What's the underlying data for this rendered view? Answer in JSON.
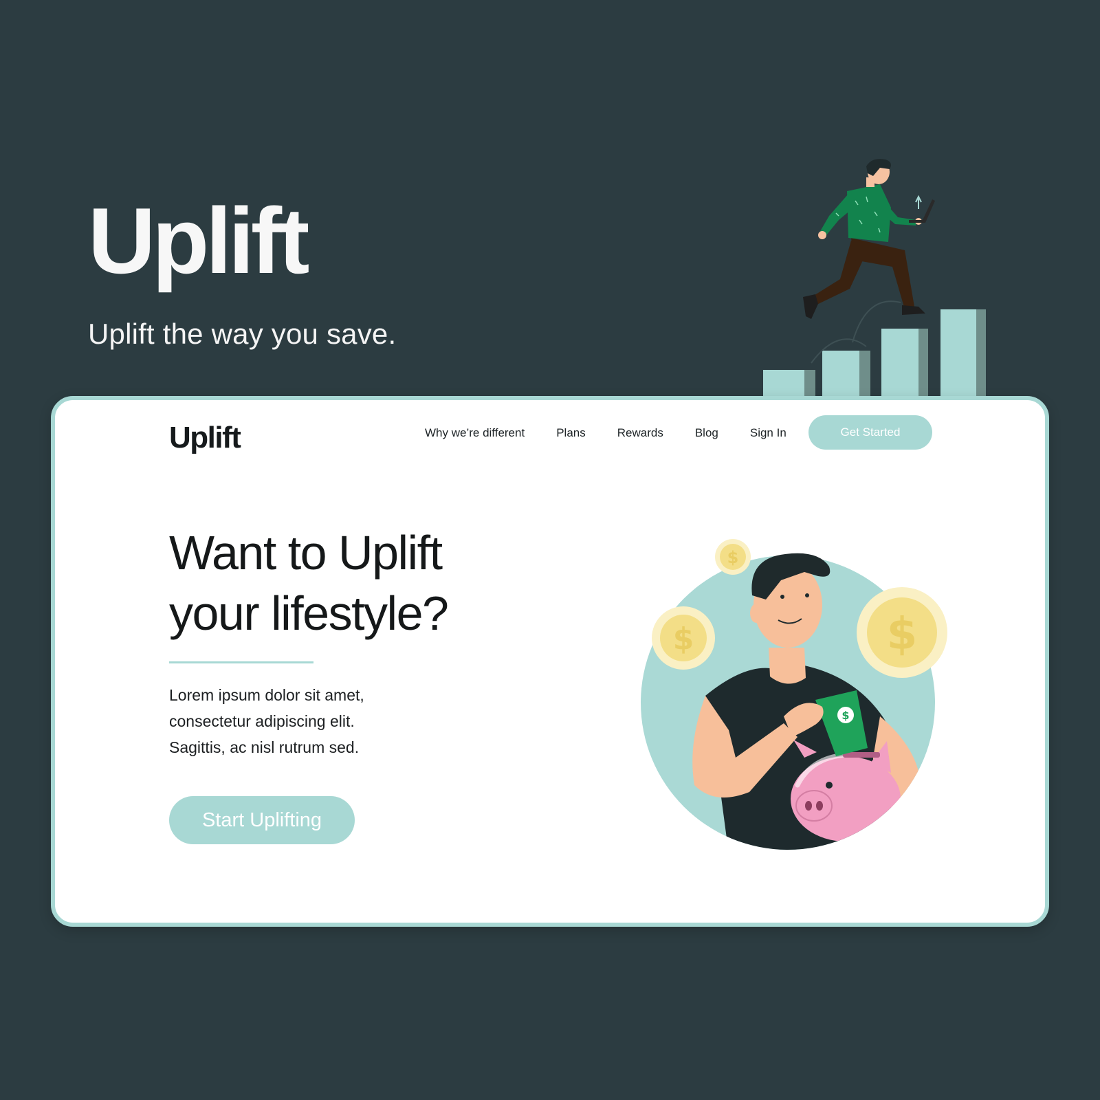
{
  "hero": {
    "title": "Uplift",
    "tagline": "Uplift the way you save."
  },
  "nav": {
    "logo": "Uplift",
    "links": [
      "Why we’re different",
      "Plans",
      "Rewards",
      "Blog",
      "Sign In"
    ],
    "cta_label": "Get Started"
  },
  "main": {
    "headline_line1": "Want to Uplift",
    "headline_line2": "your lifestyle?",
    "body_lines": [
      "Lorem ipsum dolor sit amet,",
      "consectetur adipiscing elit.",
      "Sagittis, ac nisl rutrum sed."
    ],
    "cta_label": "Start Uplifting"
  },
  "colors": {
    "background": "#2c3c41",
    "accent": "#a8d8d4",
    "card": "#ffffff",
    "text_dark": "#151819"
  },
  "illustrations": {
    "top_right": "runner-on-bar-chart-illustration",
    "hero": "man-with-piggy-bank-illustration"
  }
}
